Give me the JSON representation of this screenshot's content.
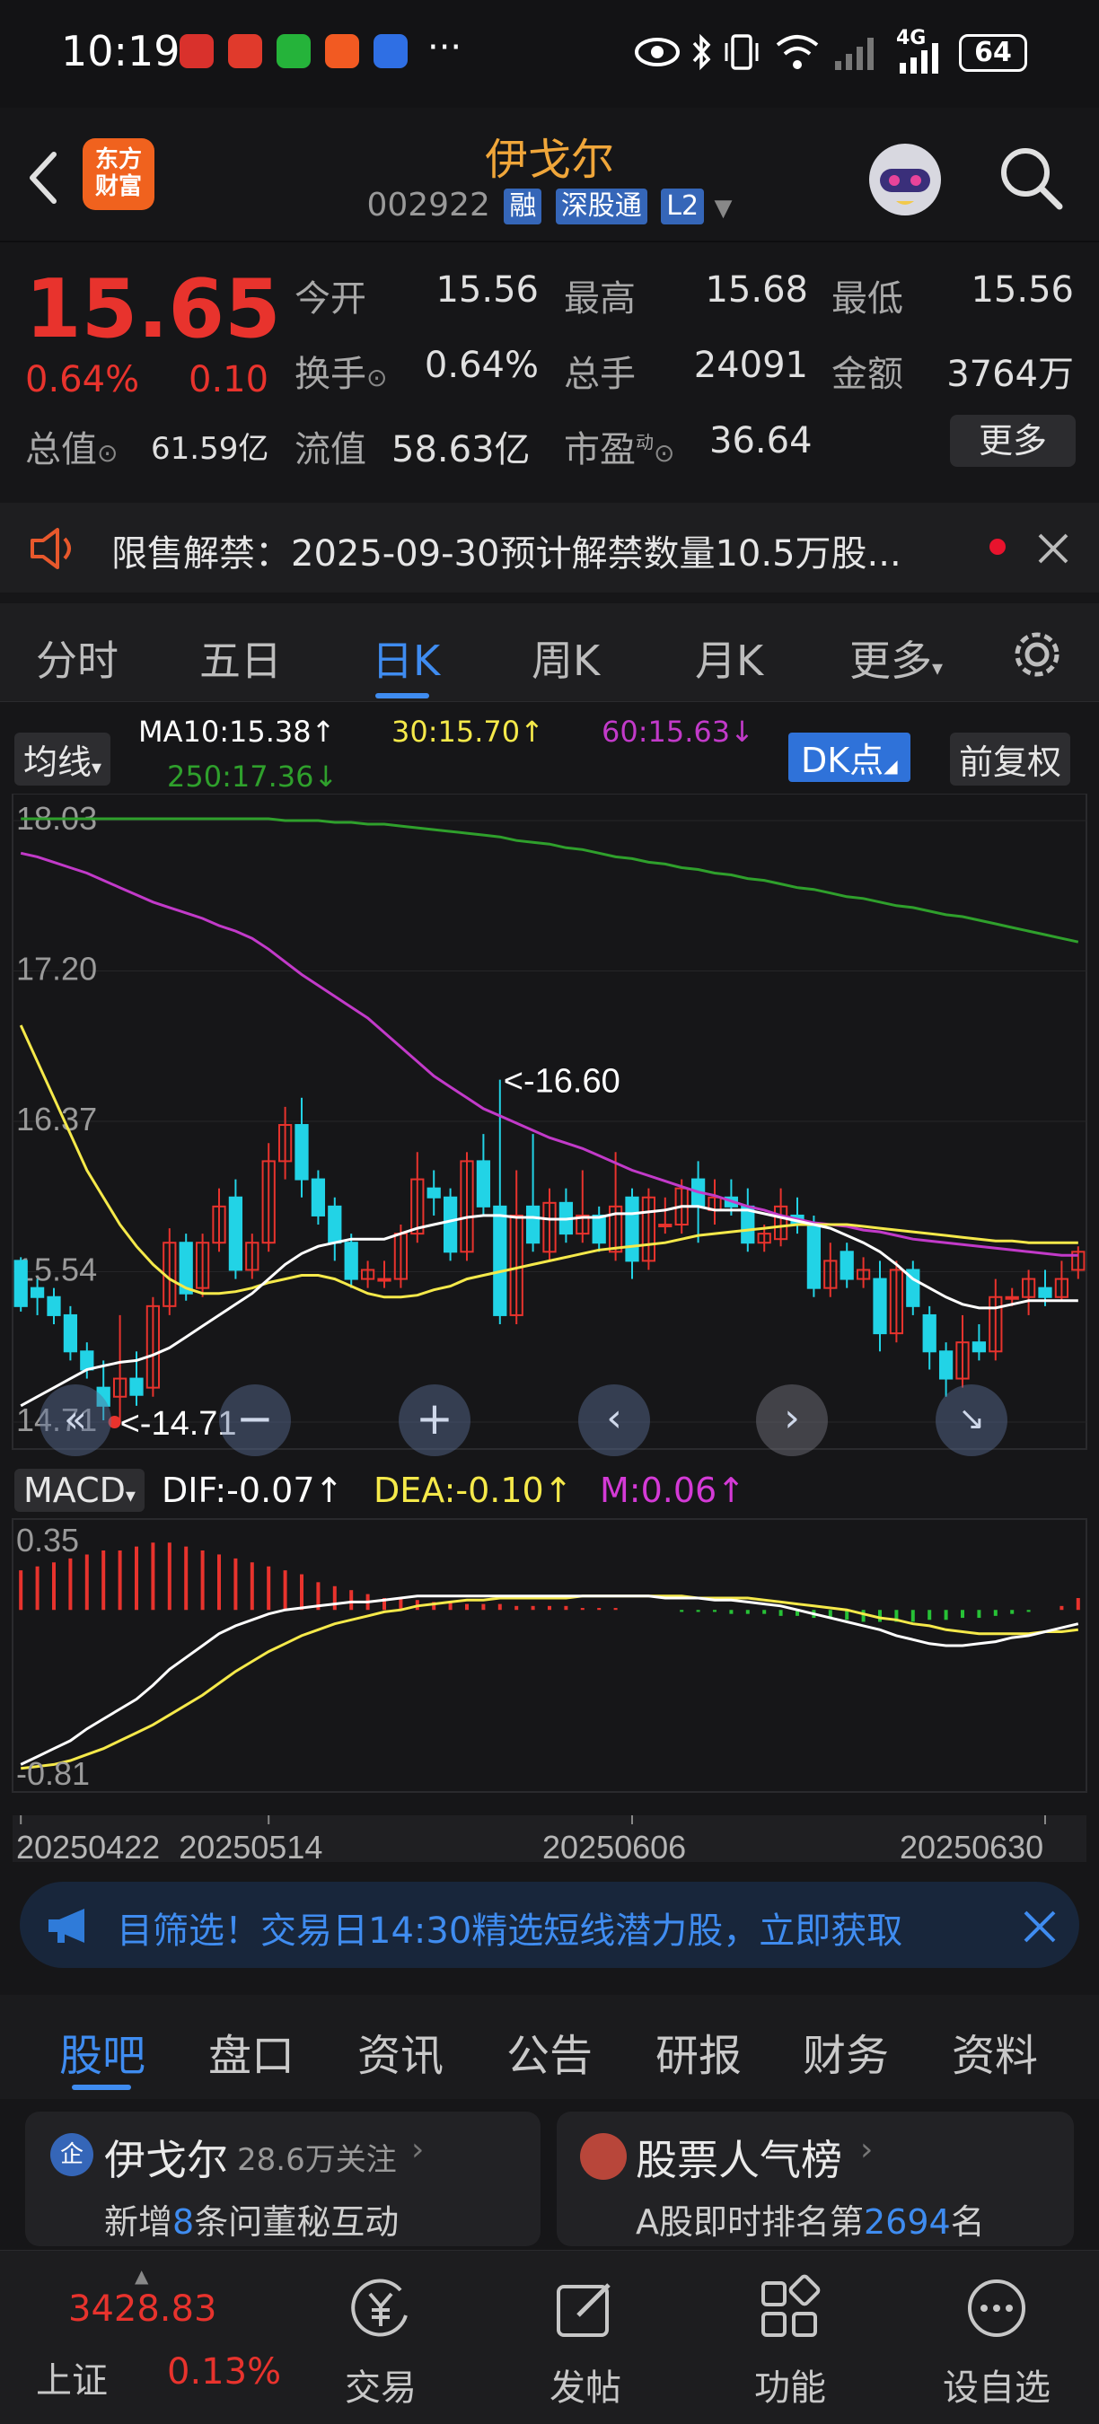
{
  "status_bar": {
    "time": "10:19",
    "more": "···",
    "network": "4G",
    "battery": "64"
  },
  "header": {
    "logo_text_1": "东方",
    "logo_text_2": "财富",
    "stock_name": "伊戈尔",
    "stock_code": "002922",
    "tags": [
      "融",
      "深股通",
      "L2"
    ]
  },
  "quote": {
    "price": "15.65",
    "change_pct": "0.64%",
    "change": "0.10",
    "open_label": "今开",
    "open": "15.56",
    "high_label": "最高",
    "high": "15.68",
    "low_label": "最低",
    "low": "15.56",
    "turnover_label": "换手",
    "turnover": "0.64%",
    "volume_label": "总手",
    "volume": "24091",
    "amount_label": "金额",
    "amount": "3764万",
    "mktcap_label": "总值",
    "mktcap": "61.59亿",
    "float_label": "流值",
    "float_cap": "58.63亿",
    "pe_label": "市盈",
    "pe_super": "动",
    "pe": "36.64",
    "more_button": "更多"
  },
  "notice": {
    "text": "限售解禁：2025-09-30预计解禁数量10.5万股..."
  },
  "chart_tabs": {
    "items": [
      "分时",
      "五日",
      "日K",
      "周K",
      "月K",
      "更多"
    ],
    "active": "日K"
  },
  "kline": {
    "ma_selector": "均线",
    "ma10": "MA10:15.38",
    "ma30": "30:15.70",
    "ma60": "60:15.63",
    "ma250": "250:17.36",
    "arrow_up": "↑",
    "arrow_down": "↓",
    "dk_button": "DK点",
    "adjust_button": "前复权",
    "max_label": "<-16.60",
    "min_label": "<-14.71",
    "colors": {
      "ma10": "#ffffff",
      "ma30": "#f5e94a",
      "ma60": "#c23ac9",
      "ma250": "#2fa02c",
      "up": "#e8332d",
      "down": "#22d3e6"
    }
  },
  "macd": {
    "selector": "MACD",
    "dif": "DIF:-0.07",
    "dea": "DEA:-0.10",
    "m": "M:0.06",
    "top_label": "0.35",
    "bottom_label": "-0.81"
  },
  "chart_data": {
    "type": "candlestick",
    "y_ticks": [
      "18.03",
      "17.20",
      "16.37",
      "15.54",
      "14.71"
    ],
    "x_ticks": [
      "20250422",
      "20250514",
      "20250606",
      "20250630"
    ],
    "ylim": [
      14.71,
      18.03
    ],
    "series": [
      {
        "name": "MA10",
        "last": 15.38
      },
      {
        "name": "MA30",
        "last": 15.7
      },
      {
        "name": "MA60",
        "last": 15.63
      },
      {
        "name": "MA250",
        "last": 17.36
      }
    ],
    "candles": [
      [
        15.6,
        15.35,
        15.62,
        15.32
      ],
      [
        15.45,
        15.4,
        15.5,
        15.3
      ],
      [
        15.4,
        15.3,
        15.45,
        15.25
      ],
      [
        15.3,
        15.1,
        15.35,
        15.05
      ],
      [
        15.1,
        15.0,
        15.15,
        14.95
      ],
      [
        14.9,
        14.8,
        15.05,
        14.72
      ],
      [
        14.85,
        14.95,
        15.3,
        14.71
      ],
      [
        14.95,
        14.86,
        15.1,
        14.8
      ],
      [
        14.9,
        15.35,
        15.4,
        14.85
      ],
      [
        15.35,
        15.7,
        15.78,
        15.3
      ],
      [
        15.7,
        15.42,
        15.75,
        15.38
      ],
      [
        15.45,
        15.7,
        15.75,
        15.4
      ],
      [
        15.7,
        15.9,
        16.0,
        15.65
      ],
      [
        15.95,
        15.55,
        16.05,
        15.5
      ],
      [
        15.55,
        15.7,
        15.75,
        15.5
      ],
      [
        15.7,
        16.15,
        16.25,
        15.65
      ],
      [
        16.15,
        16.35,
        16.45,
        16.05
      ],
      [
        16.35,
        16.05,
        16.5,
        15.95
      ],
      [
        16.05,
        15.85,
        16.1,
        15.8
      ],
      [
        15.9,
        15.7,
        15.95,
        15.6
      ],
      [
        15.7,
        15.5,
        15.75,
        15.45
      ],
      [
        15.5,
        15.55,
        15.6,
        15.45
      ],
      [
        15.5,
        15.5,
        15.6,
        15.45
      ],
      [
        15.5,
        15.75,
        15.8,
        15.45
      ],
      [
        15.75,
        16.05,
        16.2,
        15.7
      ],
      [
        16.0,
        15.95,
        16.1,
        15.85
      ],
      [
        15.95,
        15.65,
        16.0,
        15.6
      ],
      [
        15.65,
        16.15,
        16.2,
        15.6
      ],
      [
        16.15,
        15.9,
        16.3,
        15.85
      ],
      [
        15.9,
        15.3,
        16.6,
        15.25
      ],
      [
        15.3,
        15.85,
        16.1,
        15.25
      ],
      [
        15.9,
        15.7,
        16.3,
        15.65
      ],
      [
        15.65,
        15.92,
        16.0,
        15.6
      ],
      [
        15.92,
        15.75,
        16.0,
        15.7
      ],
      [
        15.75,
        15.85,
        16.1,
        15.7
      ],
      [
        15.85,
        15.7,
        15.9,
        15.65
      ],
      [
        15.65,
        15.9,
        16.2,
        15.6
      ],
      [
        15.95,
        15.6,
        16.0,
        15.5
      ],
      [
        15.6,
        15.95,
        16.0,
        15.55
      ],
      [
        15.8,
        15.8,
        15.95,
        15.75
      ],
      [
        15.8,
        16.0,
        16.05,
        15.75
      ],
      [
        16.05,
        15.9,
        16.15,
        15.7
      ],
      [
        15.88,
        15.95,
        16.05,
        15.8
      ],
      [
        15.95,
        15.9,
        16.05,
        15.85
      ],
      [
        15.9,
        15.7,
        16.0,
        15.65
      ],
      [
        15.7,
        15.75,
        15.8,
        15.65
      ],
      [
        15.72,
        15.9,
        16.0,
        15.68
      ],
      [
        15.85,
        15.8,
        15.95,
        15.75
      ],
      [
        15.8,
        15.45,
        15.85,
        15.4
      ],
      [
        15.45,
        15.6,
        15.7,
        15.4
      ],
      [
        15.65,
        15.5,
        15.7,
        15.45
      ],
      [
        15.5,
        15.55,
        15.62,
        15.45
      ],
      [
        15.5,
        15.2,
        15.6,
        15.1
      ],
      [
        15.2,
        15.55,
        15.6,
        15.15
      ],
      [
        15.55,
        15.35,
        15.6,
        15.3
      ],
      [
        15.3,
        15.1,
        15.35,
        15.0
      ],
      [
        15.1,
        14.95,
        15.15,
        14.85
      ],
      [
        14.95,
        15.15,
        15.3,
        14.9
      ],
      [
        15.15,
        15.1,
        15.25,
        15.05
      ],
      [
        15.1,
        15.4,
        15.5,
        15.05
      ],
      [
        15.4,
        15.4,
        15.45,
        15.35
      ],
      [
        15.4,
        15.5,
        15.55,
        15.3
      ],
      [
        15.45,
        15.4,
        15.55,
        15.35
      ],
      [
        15.4,
        15.5,
        15.6,
        15.38
      ],
      [
        15.55,
        15.65,
        15.68,
        15.5
      ]
    ],
    "ma10": [
      14.8,
      14.85,
      14.9,
      14.95,
      15.0,
      15.02,
      15.04,
      15.05,
      15.08,
      15.12,
      15.18,
      15.24,
      15.3,
      15.36,
      15.42,
      15.5,
      15.58,
      15.64,
      15.68,
      15.7,
      15.72,
      15.72,
      15.72,
      15.75,
      15.78,
      15.8,
      15.82,
      15.84,
      15.85,
      15.85,
      15.84,
      15.84,
      15.83,
      15.83,
      15.84,
      15.84,
      15.86,
      15.86,
      15.87,
      15.88,
      15.9,
      15.9,
      15.88,
      15.88,
      15.88,
      15.86,
      15.84,
      15.82,
      15.8,
      15.78,
      15.74,
      15.7,
      15.65,
      15.58,
      15.5,
      15.45,
      15.4,
      15.36,
      15.34,
      15.34,
      15.36,
      15.38,
      15.38,
      15.38,
      15.38
    ],
    "ma30": [
      16.9,
      16.7,
      16.5,
      16.3,
      16.1,
      15.95,
      15.8,
      15.68,
      15.58,
      15.5,
      15.45,
      15.42,
      15.42,
      15.43,
      15.45,
      15.48,
      15.5,
      15.52,
      15.52,
      15.5,
      15.46,
      15.42,
      15.4,
      15.4,
      15.41,
      15.44,
      15.46,
      15.5,
      15.52,
      15.54,
      15.56,
      15.58,
      15.6,
      15.62,
      15.64,
      15.66,
      15.67,
      15.68,
      15.69,
      15.7,
      15.72,
      15.74,
      15.75,
      15.76,
      15.77,
      15.78,
      15.79,
      15.8,
      15.8,
      15.8,
      15.8,
      15.79,
      15.78,
      15.77,
      15.76,
      15.75,
      15.74,
      15.73,
      15.72,
      15.71,
      15.71,
      15.7,
      15.7,
      15.7,
      15.7
    ],
    "ma60": [
      17.85,
      17.83,
      17.8,
      17.77,
      17.74,
      17.7,
      17.66,
      17.62,
      17.58,
      17.55,
      17.52,
      17.49,
      17.45,
      17.42,
      17.38,
      17.32,
      17.25,
      17.18,
      17.12,
      17.06,
      17.0,
      16.94,
      16.86,
      16.78,
      16.7,
      16.62,
      16.56,
      16.5,
      16.44,
      16.4,
      16.36,
      16.32,
      16.28,
      16.25,
      16.22,
      16.18,
      16.14,
      16.1,
      16.07,
      16.04,
      16.01,
      15.98,
      15.96,
      15.93,
      15.9,
      15.88,
      15.85,
      15.83,
      15.81,
      15.8,
      15.79,
      15.77,
      15.76,
      15.74,
      15.72,
      15.71,
      15.7,
      15.69,
      15.68,
      15.67,
      15.66,
      15.65,
      15.64,
      15.63,
      15.63
    ],
    "ma250": [
      18.04,
      18.04,
      18.04,
      18.04,
      18.04,
      18.04,
      18.04,
      18.04,
      18.04,
      18.04,
      18.04,
      18.04,
      18.04,
      18.04,
      18.04,
      18.04,
      18.03,
      18.03,
      18.03,
      18.02,
      18.02,
      18.01,
      18.01,
      18.0,
      17.99,
      17.98,
      17.97,
      17.96,
      17.95,
      17.94,
      17.92,
      17.91,
      17.9,
      17.88,
      17.87,
      17.85,
      17.83,
      17.82,
      17.8,
      17.79,
      17.77,
      17.76,
      17.74,
      17.73,
      17.71,
      17.7,
      17.68,
      17.66,
      17.65,
      17.63,
      17.61,
      17.6,
      17.58,
      17.56,
      17.55,
      17.53,
      17.51,
      17.5,
      17.48,
      17.46,
      17.44,
      17.42,
      17.4,
      17.38,
      17.36
    ],
    "macd_ylim": [
      -0.81,
      0.35
    ],
    "macd_dif": [
      -0.78,
      -0.74,
      -0.7,
      -0.66,
      -0.6,
      -0.55,
      -0.5,
      -0.45,
      -0.38,
      -0.3,
      -0.24,
      -0.18,
      -0.12,
      -0.08,
      -0.05,
      -0.02,
      0.0,
      0.01,
      0.02,
      0.03,
      0.04,
      0.04,
      0.05,
      0.06,
      0.07,
      0.07,
      0.07,
      0.07,
      0.07,
      0.07,
      0.07,
      0.07,
      0.07,
      0.07,
      0.07,
      0.07,
      0.07,
      0.07,
      0.07,
      0.06,
      0.06,
      0.06,
      0.05,
      0.05,
      0.04,
      0.03,
      0.02,
      0.0,
      -0.02,
      -0.04,
      -0.06,
      -0.08,
      -0.1,
      -0.13,
      -0.15,
      -0.17,
      -0.18,
      -0.18,
      -0.17,
      -0.16,
      -0.14,
      -0.13,
      -0.11,
      -0.09,
      -0.07
    ],
    "macd_dea": [
      -0.8,
      -0.79,
      -0.78,
      -0.76,
      -0.73,
      -0.7,
      -0.66,
      -0.62,
      -0.58,
      -0.53,
      -0.48,
      -0.43,
      -0.37,
      -0.31,
      -0.26,
      -0.21,
      -0.17,
      -0.13,
      -0.1,
      -0.07,
      -0.05,
      -0.03,
      -0.01,
      0.0,
      0.02,
      0.03,
      0.04,
      0.05,
      0.05,
      0.06,
      0.06,
      0.06,
      0.06,
      0.06,
      0.07,
      0.07,
      0.07,
      0.07,
      0.07,
      0.07,
      0.07,
      0.06,
      0.06,
      0.06,
      0.06,
      0.05,
      0.04,
      0.03,
      0.02,
      0.01,
      0.0,
      -0.02,
      -0.04,
      -0.05,
      -0.07,
      -0.08,
      -0.1,
      -0.11,
      -0.12,
      -0.12,
      -0.12,
      -0.12,
      -0.11,
      -0.11,
      -0.1
    ],
    "macd_bar": [
      0.2,
      0.22,
      0.24,
      0.26,
      0.28,
      0.3,
      0.3,
      0.32,
      0.34,
      0.34,
      0.32,
      0.3,
      0.28,
      0.26,
      0.24,
      0.22,
      0.2,
      0.18,
      0.14,
      0.12,
      0.1,
      0.08,
      0.06,
      0.06,
      0.05,
      0.04,
      0.04,
      0.03,
      0.03,
      0.03,
      0.02,
      0.02,
      0.02,
      0.02,
      0.01,
      0.01,
      0.01,
      0.0,
      0.0,
      0.0,
      -0.01,
      -0.01,
      -0.01,
      -0.02,
      -0.02,
      -0.02,
      -0.03,
      -0.03,
      -0.04,
      -0.04,
      -0.05,
      -0.06,
      -0.06,
      -0.06,
      -0.06,
      -0.05,
      -0.05,
      -0.04,
      -0.04,
      -0.03,
      -0.02,
      -0.01,
      0.0,
      0.02,
      0.06
    ]
  },
  "ad_bar": {
    "text": "目筛选！交易日14:30精选短线潜力股，立即获取"
  },
  "bottom_tabs": {
    "items": [
      "股吧",
      "盘口",
      "资讯",
      "公告",
      "研报",
      "财务",
      "资料"
    ],
    "active": "股吧"
  },
  "cards": {
    "left_title": "伊戈尔",
    "left_followers": "28.6万关注",
    "left_sub_prefix": "新增",
    "left_sub_count": "8",
    "left_sub_suffix": "条问董秘互动",
    "right_title": "股票人气榜",
    "right_sub_prefix": "A股即时排名第",
    "right_sub_rank": "2694",
    "right_sub_suffix": "名"
  },
  "bottom_nav": {
    "index_value": "3428.83",
    "index_name": "上证",
    "index_change": "0.13%",
    "trade": "交易",
    "post": "发帖",
    "functions": "功能",
    "watchlist": "设自选"
  }
}
